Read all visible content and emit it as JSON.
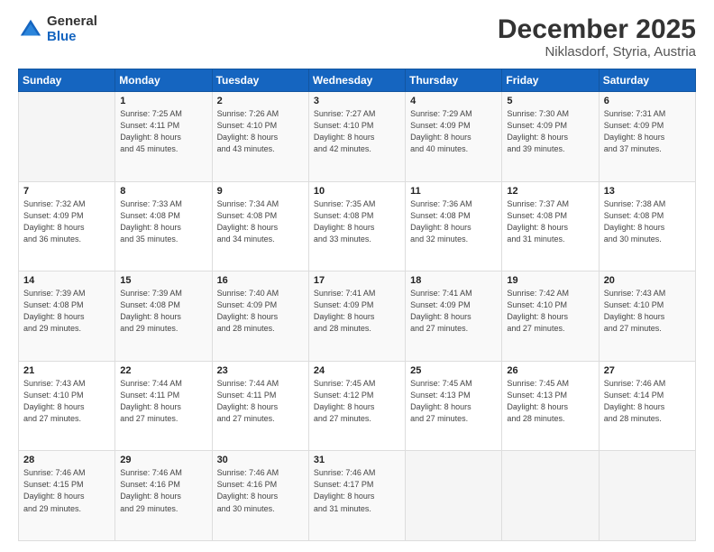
{
  "logo": {
    "general": "General",
    "blue": "Blue"
  },
  "title": "December 2025",
  "subtitle": "Niklasdorf, Styria, Austria",
  "days_header": [
    "Sunday",
    "Monday",
    "Tuesday",
    "Wednesday",
    "Thursday",
    "Friday",
    "Saturday"
  ],
  "weeks": [
    [
      {
        "day": "",
        "info": ""
      },
      {
        "day": "1",
        "info": "Sunrise: 7:25 AM\nSunset: 4:11 PM\nDaylight: 8 hours\nand 45 minutes."
      },
      {
        "day": "2",
        "info": "Sunrise: 7:26 AM\nSunset: 4:10 PM\nDaylight: 8 hours\nand 43 minutes."
      },
      {
        "day": "3",
        "info": "Sunrise: 7:27 AM\nSunset: 4:10 PM\nDaylight: 8 hours\nand 42 minutes."
      },
      {
        "day": "4",
        "info": "Sunrise: 7:29 AM\nSunset: 4:09 PM\nDaylight: 8 hours\nand 40 minutes."
      },
      {
        "day": "5",
        "info": "Sunrise: 7:30 AM\nSunset: 4:09 PM\nDaylight: 8 hours\nand 39 minutes."
      },
      {
        "day": "6",
        "info": "Sunrise: 7:31 AM\nSunset: 4:09 PM\nDaylight: 8 hours\nand 37 minutes."
      }
    ],
    [
      {
        "day": "7",
        "info": "Sunrise: 7:32 AM\nSunset: 4:09 PM\nDaylight: 8 hours\nand 36 minutes."
      },
      {
        "day": "8",
        "info": "Sunrise: 7:33 AM\nSunset: 4:08 PM\nDaylight: 8 hours\nand 35 minutes."
      },
      {
        "day": "9",
        "info": "Sunrise: 7:34 AM\nSunset: 4:08 PM\nDaylight: 8 hours\nand 34 minutes."
      },
      {
        "day": "10",
        "info": "Sunrise: 7:35 AM\nSunset: 4:08 PM\nDaylight: 8 hours\nand 33 minutes."
      },
      {
        "day": "11",
        "info": "Sunrise: 7:36 AM\nSunset: 4:08 PM\nDaylight: 8 hours\nand 32 minutes."
      },
      {
        "day": "12",
        "info": "Sunrise: 7:37 AM\nSunset: 4:08 PM\nDaylight: 8 hours\nand 31 minutes."
      },
      {
        "day": "13",
        "info": "Sunrise: 7:38 AM\nSunset: 4:08 PM\nDaylight: 8 hours\nand 30 minutes."
      }
    ],
    [
      {
        "day": "14",
        "info": "Sunrise: 7:39 AM\nSunset: 4:08 PM\nDaylight: 8 hours\nand 29 minutes."
      },
      {
        "day": "15",
        "info": "Sunrise: 7:39 AM\nSunset: 4:08 PM\nDaylight: 8 hours\nand 29 minutes."
      },
      {
        "day": "16",
        "info": "Sunrise: 7:40 AM\nSunset: 4:09 PM\nDaylight: 8 hours\nand 28 minutes."
      },
      {
        "day": "17",
        "info": "Sunrise: 7:41 AM\nSunset: 4:09 PM\nDaylight: 8 hours\nand 28 minutes."
      },
      {
        "day": "18",
        "info": "Sunrise: 7:41 AM\nSunset: 4:09 PM\nDaylight: 8 hours\nand 27 minutes."
      },
      {
        "day": "19",
        "info": "Sunrise: 7:42 AM\nSunset: 4:10 PM\nDaylight: 8 hours\nand 27 minutes."
      },
      {
        "day": "20",
        "info": "Sunrise: 7:43 AM\nSunset: 4:10 PM\nDaylight: 8 hours\nand 27 minutes."
      }
    ],
    [
      {
        "day": "21",
        "info": "Sunrise: 7:43 AM\nSunset: 4:10 PM\nDaylight: 8 hours\nand 27 minutes."
      },
      {
        "day": "22",
        "info": "Sunrise: 7:44 AM\nSunset: 4:11 PM\nDaylight: 8 hours\nand 27 minutes."
      },
      {
        "day": "23",
        "info": "Sunrise: 7:44 AM\nSunset: 4:11 PM\nDaylight: 8 hours\nand 27 minutes."
      },
      {
        "day": "24",
        "info": "Sunrise: 7:45 AM\nSunset: 4:12 PM\nDaylight: 8 hours\nand 27 minutes."
      },
      {
        "day": "25",
        "info": "Sunrise: 7:45 AM\nSunset: 4:13 PM\nDaylight: 8 hours\nand 27 minutes."
      },
      {
        "day": "26",
        "info": "Sunrise: 7:45 AM\nSunset: 4:13 PM\nDaylight: 8 hours\nand 28 minutes."
      },
      {
        "day": "27",
        "info": "Sunrise: 7:46 AM\nSunset: 4:14 PM\nDaylight: 8 hours\nand 28 minutes."
      }
    ],
    [
      {
        "day": "28",
        "info": "Sunrise: 7:46 AM\nSunset: 4:15 PM\nDaylight: 8 hours\nand 29 minutes."
      },
      {
        "day": "29",
        "info": "Sunrise: 7:46 AM\nSunset: 4:16 PM\nDaylight: 8 hours\nand 29 minutes."
      },
      {
        "day": "30",
        "info": "Sunrise: 7:46 AM\nSunset: 4:16 PM\nDaylight: 8 hours\nand 30 minutes."
      },
      {
        "day": "31",
        "info": "Sunrise: 7:46 AM\nSunset: 4:17 PM\nDaylight: 8 hours\nand 31 minutes."
      },
      {
        "day": "",
        "info": ""
      },
      {
        "day": "",
        "info": ""
      },
      {
        "day": "",
        "info": ""
      }
    ]
  ]
}
